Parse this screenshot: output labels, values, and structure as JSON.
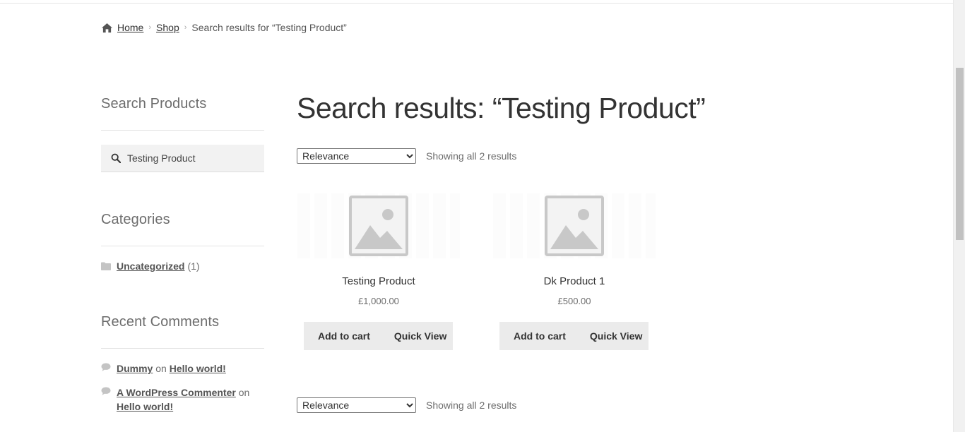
{
  "breadcrumb": {
    "home": "Home",
    "shop": "Shop",
    "current": "Search results for “Testing Product”"
  },
  "sidebar": {
    "search_title": "Search Products",
    "search_value": "Testing Product",
    "categories_title": "Categories",
    "categories": [
      {
        "name": "Uncategorized",
        "count": "(1)"
      }
    ],
    "recent_comments_title": "Recent Comments",
    "comments": [
      {
        "author": "Dummy",
        "on": "on",
        "post": "Hello world!"
      },
      {
        "author": "A WordPress Commenter",
        "on": "on",
        "post": "Hello world!"
      }
    ]
  },
  "main": {
    "title": "Search results: “Testing Product”",
    "orderby": {
      "selected": "Relevance",
      "options": [
        "Relevance"
      ]
    },
    "result_count": "Showing all 2 results",
    "products": [
      {
        "name": "Testing Product",
        "price": "£1,000.00",
        "add_label": "Add to cart",
        "quick_label": "Quick View"
      },
      {
        "name": "Dk Product 1",
        "price": "£500.00",
        "add_label": "Add to cart",
        "quick_label": "Quick View"
      }
    ]
  },
  "icons": {
    "home": "home-icon",
    "search": "search-icon",
    "folder": "folder-icon",
    "comment": "comment-icon",
    "placeholder": "image-placeholder-icon"
  }
}
